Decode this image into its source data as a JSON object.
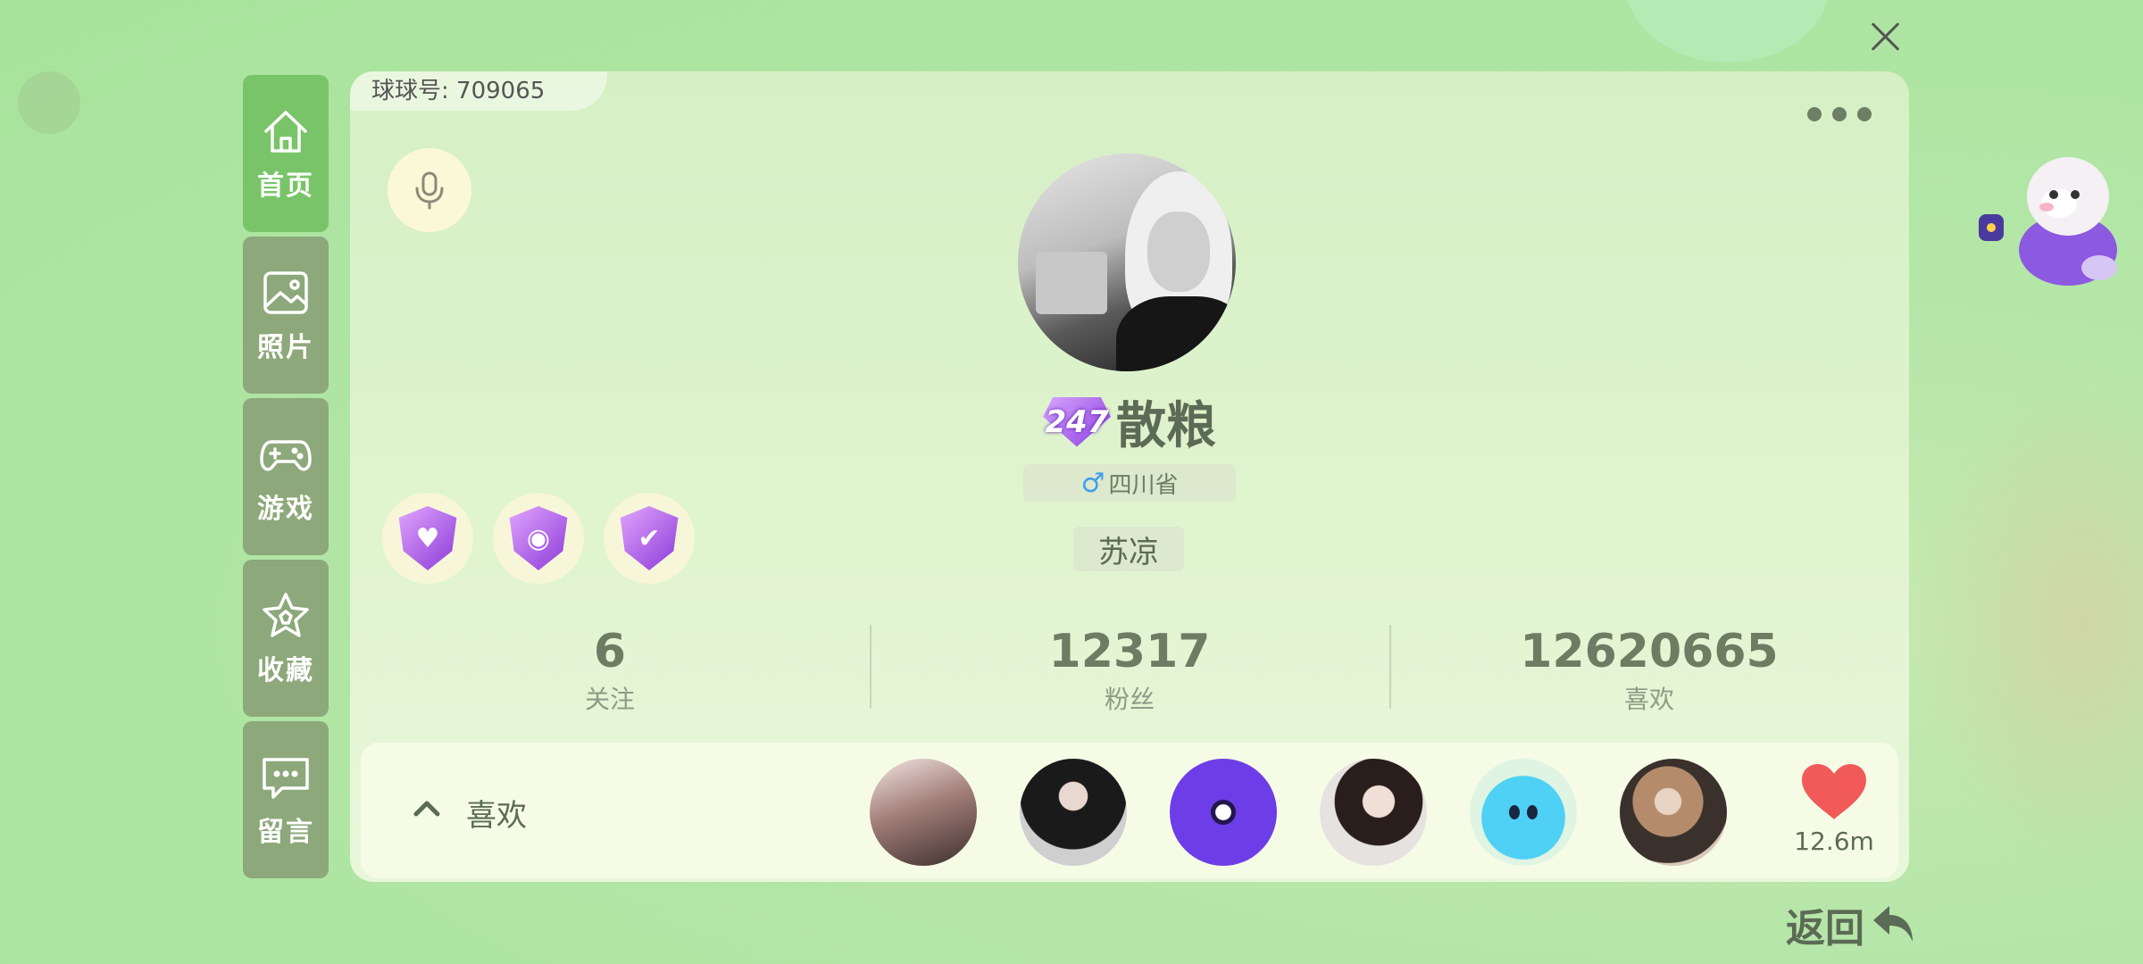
{
  "header": {
    "close_label": "close"
  },
  "sidebar": {
    "items": [
      {
        "label": "首页",
        "icon": "home-icon",
        "active": true
      },
      {
        "label": "照片",
        "icon": "photo-icon",
        "active": false
      },
      {
        "label": "游戏",
        "icon": "gamepad-icon",
        "active": false
      },
      {
        "label": "收藏",
        "icon": "star-icon",
        "active": false
      },
      {
        "label": "留言",
        "icon": "message-icon",
        "active": false
      }
    ]
  },
  "profile": {
    "id_label": "球球号: 709065",
    "level": "247",
    "nickname": "散粮",
    "gender_symbol": "♂",
    "location": "四川省",
    "signature": "苏凉",
    "badges": [
      "heart-badge",
      "rank-badge",
      "check-badge"
    ]
  },
  "stats": [
    {
      "value": "6",
      "label": "关注"
    },
    {
      "value": "12317",
      "label": "粉丝"
    },
    {
      "value": "12620665",
      "label": "喜欢"
    }
  ],
  "likes": {
    "title": "喜欢",
    "heart_count": "12.6m",
    "fans": [
      "fan-avatar",
      "fan-avatar",
      "fan-avatar",
      "fan-avatar",
      "fan-avatar",
      "fan-avatar"
    ]
  },
  "footer": {
    "back_label": "返回"
  },
  "colors": {
    "accent_green": "#79c468",
    "sidebar_gray": "#8da87a",
    "heart_red": "#f25a5a",
    "male_blue": "#3e9ff0"
  }
}
